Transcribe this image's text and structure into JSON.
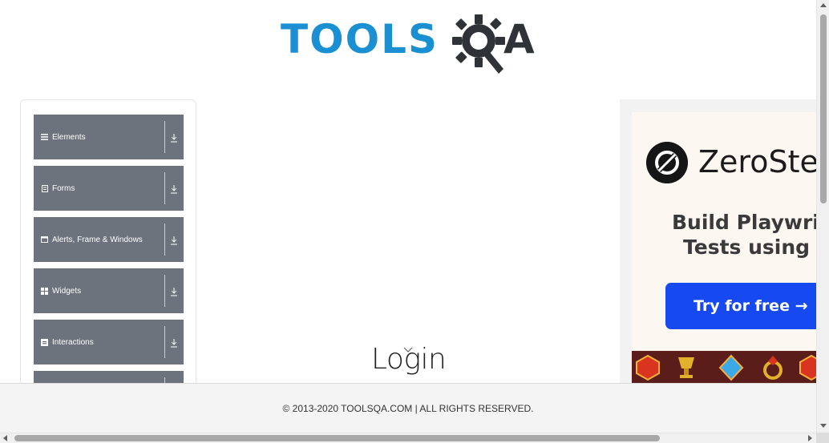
{
  "header": {
    "logo_text": "TOOLS",
    "logo_suffix": "A"
  },
  "sidebar": {
    "groups": [
      {
        "label": "Elements",
        "icon": "list-icon"
      },
      {
        "label": "Forms",
        "icon": "form-icon"
      },
      {
        "label": "Alerts, Frame & Windows",
        "icon": "window-icon"
      },
      {
        "label": "Widgets",
        "icon": "grid-icon"
      },
      {
        "label": "Interactions",
        "icon": "interaction-icon"
      },
      {
        "label": "",
        "icon": ""
      }
    ]
  },
  "main": {
    "title": "Login"
  },
  "ad": {
    "brand": "ZeroSte",
    "headline_line1": "Build Playwrigh",
    "headline_line2": "Tests using A",
    "cta": "Try for free →"
  },
  "footer": {
    "copyright": "© 2013-2020 TOOLSQA.COM | ALL RIGHTS RESERVED."
  },
  "colors": {
    "brand_blue": "#1a8fd1",
    "sidebar_group": "#6c737d",
    "ad_cta": "#1749f0"
  }
}
